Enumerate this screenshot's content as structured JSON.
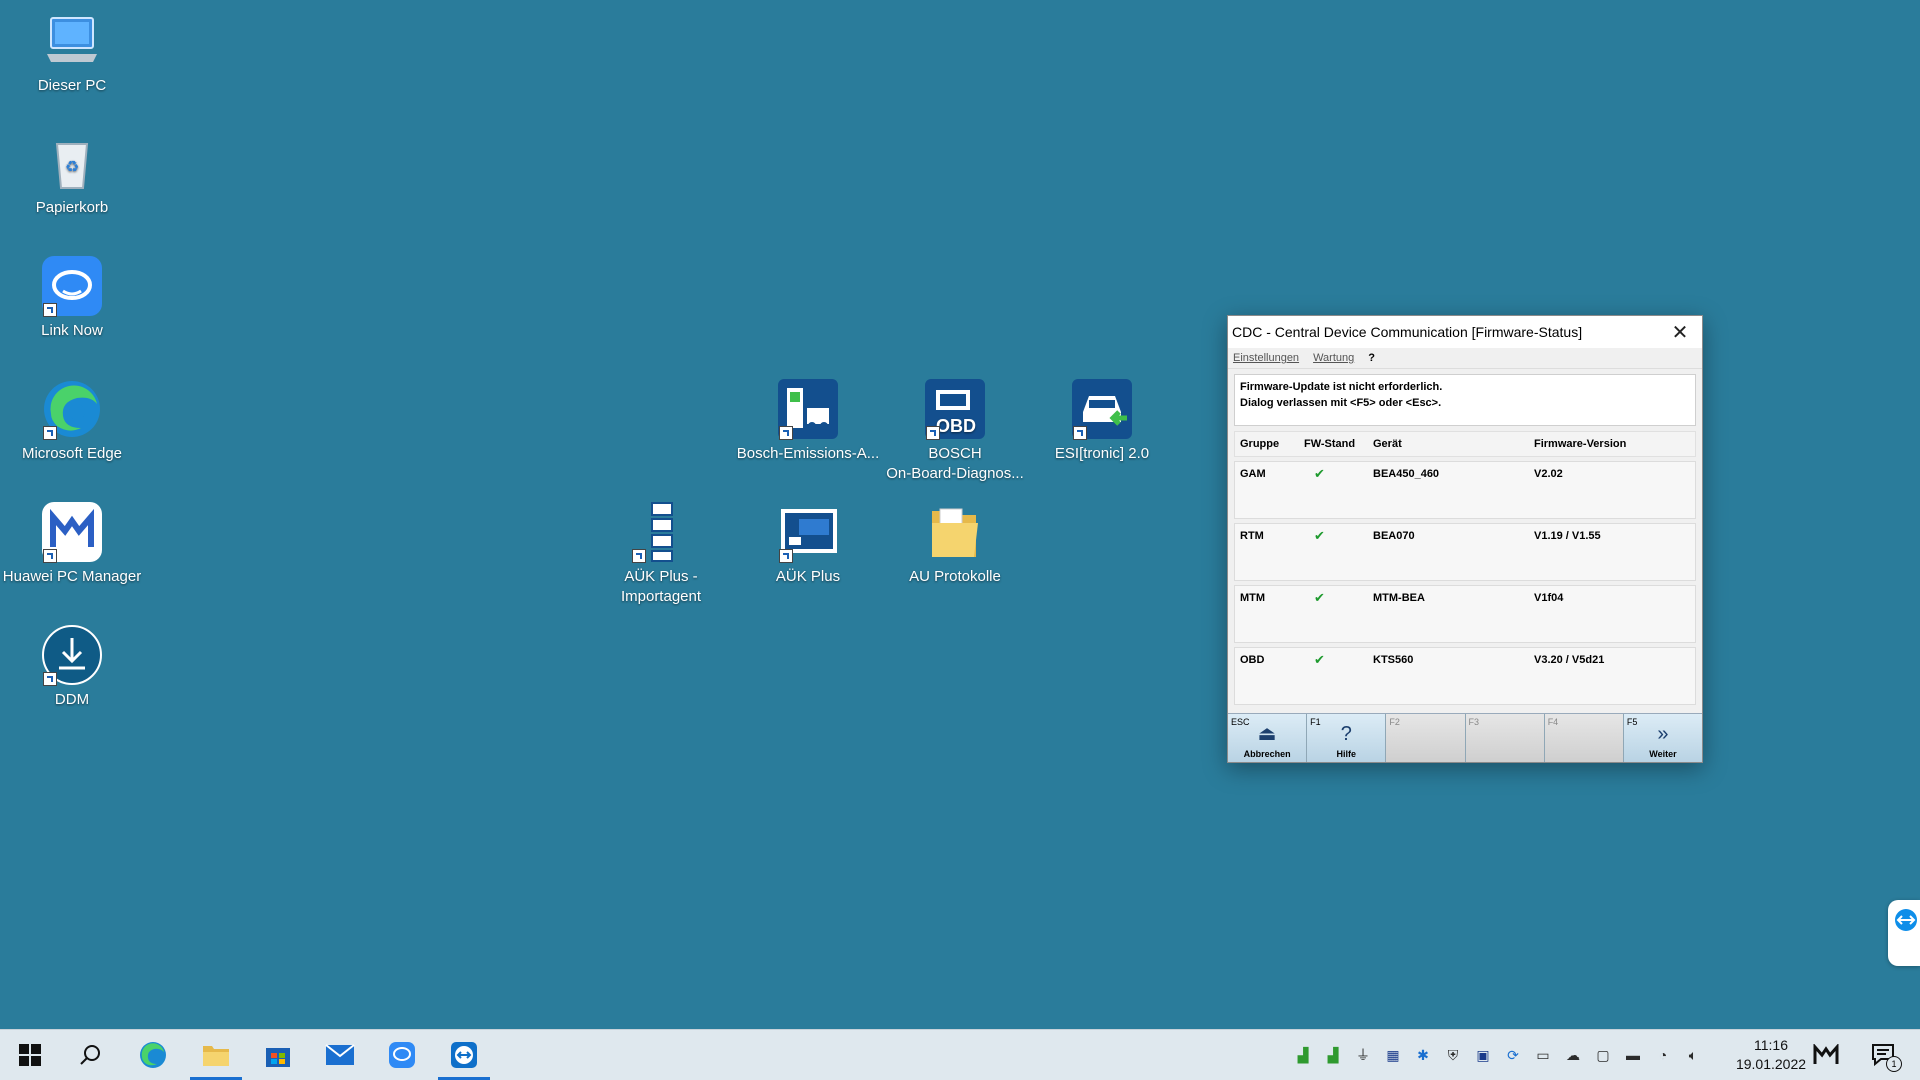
{
  "desktop": {
    "icons": [
      {
        "label": "Dieser PC",
        "icon": "computer-icon"
      },
      {
        "label": "Papierkorb",
        "icon": "recycle-bin-icon"
      },
      {
        "label": "Link Now",
        "icon": "link-now-icon"
      },
      {
        "label": "Microsoft Edge",
        "icon": "edge-icon"
      },
      {
        "label": "Huawei PC Manager",
        "icon": "huawei-pc-manager-icon"
      },
      {
        "label": "DDM",
        "icon": "download-icon"
      },
      {
        "label": "Bosch-Emissions-A...",
        "icon": "bosch-emissions-icon"
      },
      {
        "label": "BOSCH\nOn-Board-Diagnos...",
        "icon": "obd-icon"
      },
      {
        "label": "ESI[tronic] 2.0",
        "icon": "esitronic-icon"
      },
      {
        "label": "AÜK Plus -\nImportagent",
        "icon": "import-agent-icon"
      },
      {
        "label": "AÜK Plus",
        "icon": "auk-plus-icon"
      },
      {
        "label": "AU Protokolle",
        "icon": "folder-icon"
      }
    ]
  },
  "dialog": {
    "title": "CDC - Central Device Communication [Firmware-Status]",
    "menu": [
      "Einstellungen",
      "Wartung",
      "?"
    ],
    "message_line1": "Firmware-Update ist nicht erforderlich.",
    "message_line2": "Dialog verlassen mit <F5> oder <Esc>.",
    "columns": [
      "Gruppe",
      "FW-Stand",
      "Gerät",
      "Firmware-Version"
    ],
    "rows": [
      {
        "gruppe": "GAM",
        "stand": "✔",
        "geraet": "BEA450_460",
        "version": "V2.02"
      },
      {
        "gruppe": "RTM",
        "stand": "✔",
        "geraet": "BEA070",
        "version": "V1.19 / V1.55"
      },
      {
        "gruppe": "MTM",
        "stand": "✔",
        "geraet": "MTM-BEA",
        "version": "V1f04"
      },
      {
        "gruppe": "OBD",
        "stand": "✔",
        "geraet": "KTS560",
        "version": "V3.20 / V5d21"
      }
    ],
    "fkeys": [
      {
        "key": "ESC",
        "label": "Abbrechen"
      },
      {
        "key": "F1",
        "label": "Hilfe"
      },
      {
        "key": "F2",
        "label": ""
      },
      {
        "key": "F3",
        "label": ""
      },
      {
        "key": "F4",
        "label": ""
      },
      {
        "key": "F5",
        "label": "Weiter"
      }
    ]
  },
  "taskbar": {
    "time": "11:16",
    "date": "19.01.2022",
    "notification_count": "1",
    "colors": {
      "accent": "#1a6fd0",
      "desktop": "#2a7c9b"
    }
  }
}
